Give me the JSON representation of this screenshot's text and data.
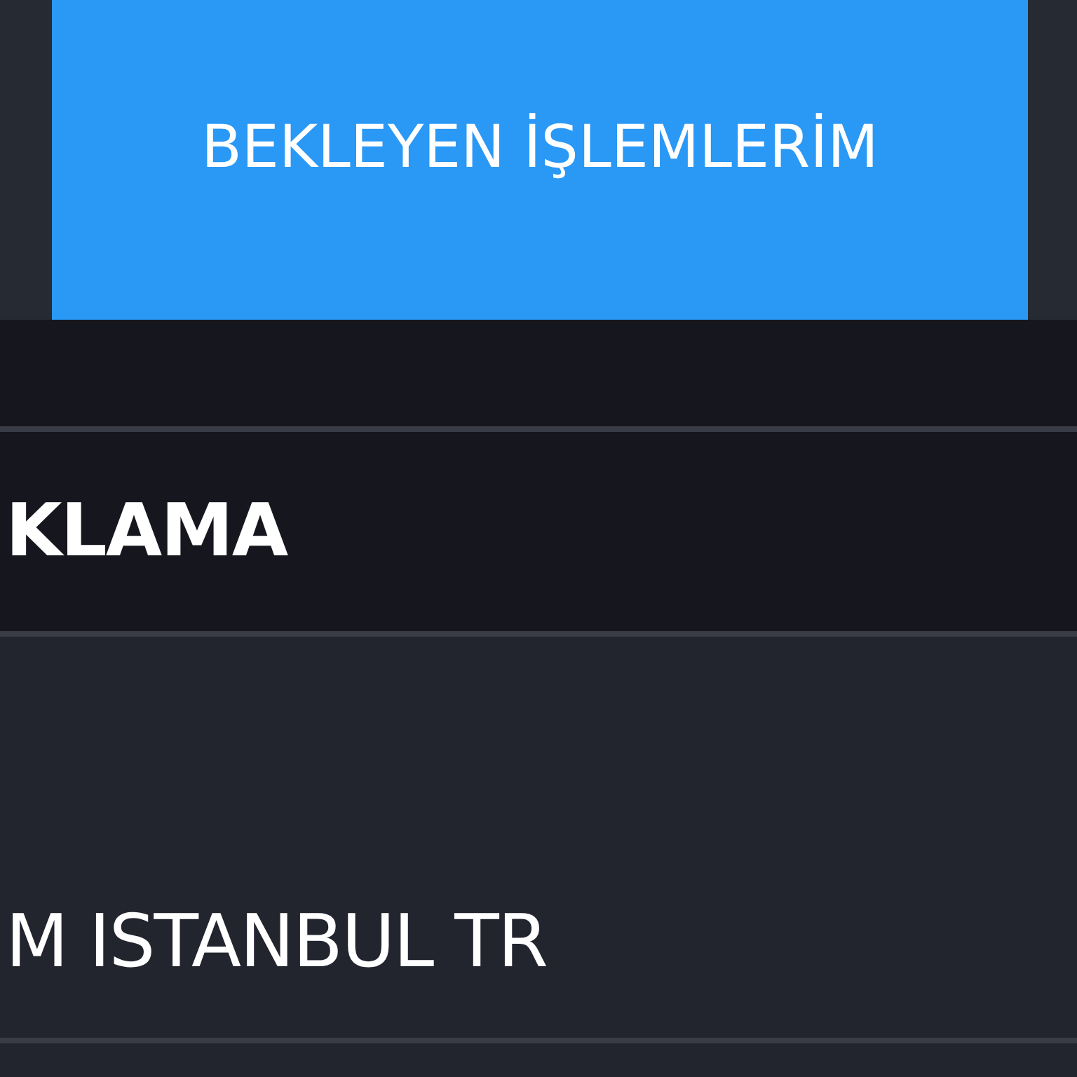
{
  "tabs": [
    {
      "label": "BEKLEYEN İŞLEMLERİM",
      "selected": true
    }
  ],
  "table": {
    "columns": [
      "KLAMA"
    ],
    "rows": [
      [
        "M ISTANBUL TR"
      ]
    ]
  }
}
